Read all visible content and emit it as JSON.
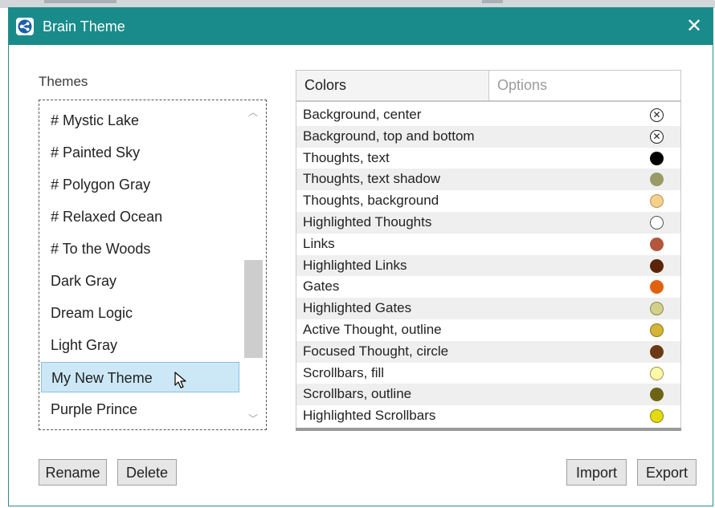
{
  "window": {
    "title": "Brain Theme",
    "close_icon": "close-icon",
    "app_icon": "brain-app-icon"
  },
  "themes": {
    "label": "Themes",
    "items": [
      {
        "label": "# Mystic Lake",
        "selected": false
      },
      {
        "label": "# Painted Sky",
        "selected": false
      },
      {
        "label": "# Polygon Gray",
        "selected": false
      },
      {
        "label": "# Relaxed Ocean",
        "selected": false
      },
      {
        "label": "# To the Woods",
        "selected": false
      },
      {
        "label": "Dark Gray",
        "selected": false
      },
      {
        "label": "Dream Logic",
        "selected": false
      },
      {
        "label": "Light Gray",
        "selected": false
      },
      {
        "label": "My New Theme",
        "selected": true
      },
      {
        "label": "Purple Prince",
        "selected": false
      }
    ]
  },
  "tabs": [
    {
      "label": "Colors",
      "active": true
    },
    {
      "label": "Options",
      "active": false
    }
  ],
  "colors": [
    {
      "label": "Background, center",
      "swatch": "none"
    },
    {
      "label": "Background, top and bottom",
      "swatch": "none"
    },
    {
      "label": "Thoughts, text",
      "swatch": "#000000"
    },
    {
      "label": "Thoughts, text shadow",
      "swatch": "#9a9a66"
    },
    {
      "label": "Thoughts, background",
      "swatch": "#f5d08a"
    },
    {
      "label": "Highlighted Thoughts",
      "swatch": "#ffffff"
    },
    {
      "label": "Links",
      "swatch": "#b3563b"
    },
    {
      "label": "Highlighted Links",
      "swatch": "#5a2408"
    },
    {
      "label": "Gates",
      "swatch": "#e0620f"
    },
    {
      "label": "Highlighted Gates",
      "swatch": "#d2d08a"
    },
    {
      "label": "Active Thought, outline",
      "swatch": "#d4b535"
    },
    {
      "label": "Focused Thought, circle",
      "swatch": "#6b3a14"
    },
    {
      "label": "Scrollbars, fill",
      "swatch": "#fffaa8"
    },
    {
      "label": "Scrollbars, outline",
      "swatch": "#6b6414"
    },
    {
      "label": "Highlighted Scrollbars",
      "swatch": "#e3db10"
    }
  ],
  "buttons": {
    "rename": "Rename",
    "delete": "Delete",
    "import": "Import",
    "export": "Export"
  },
  "accent_color": "#1a8b8b",
  "selection_color": "#cce8f6"
}
